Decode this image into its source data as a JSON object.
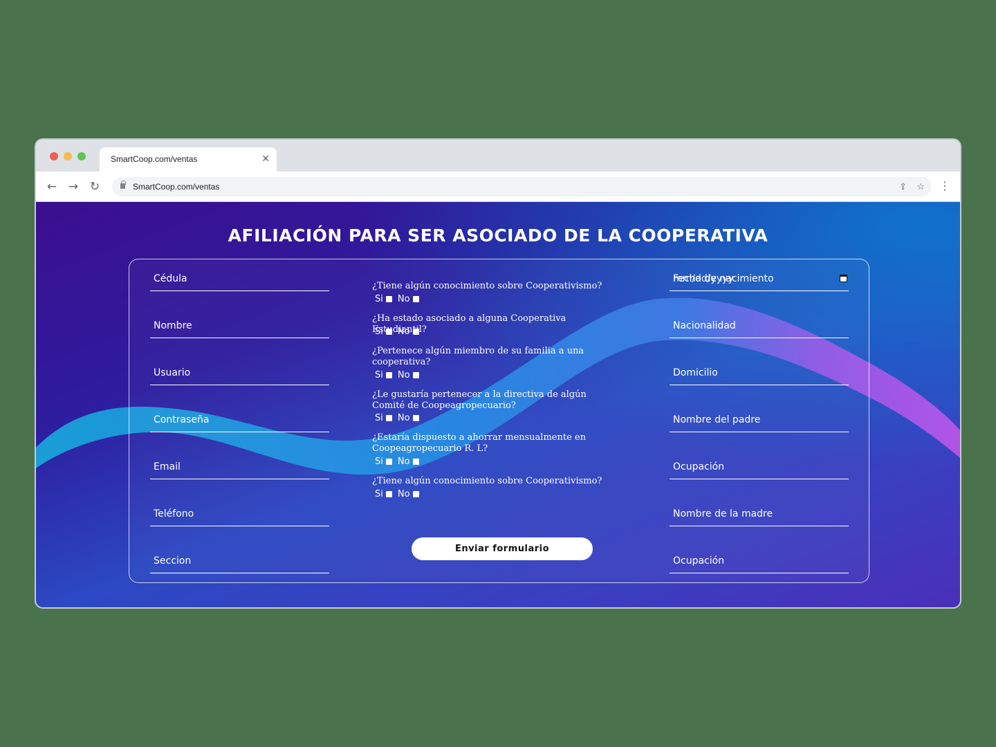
{
  "browser": {
    "tab_title": "SmartCoop.com/ventas",
    "url": "SmartCoop.com/ventas"
  },
  "page": {
    "title": "AFILIACIÓN PARA SER ASOCIADO DE LA COOPERATIVA",
    "left_fields": [
      "Cédula",
      "Nombre",
      "Usuario",
      "Contraseña",
      "Email",
      "Teléfono",
      "Seccion"
    ],
    "right_fields": [
      "Fecha de nacimiento",
      "Nacionalidad",
      "Domicilio",
      "Nombre del padre",
      "Ocupación",
      "Nombre de la madre",
      "Ocupación"
    ],
    "date_placeholder": "mm/dd/yyyy",
    "questions": [
      "¿Tiene algún conocimiento sobre Cooperativismo?",
      "¿Ha estado asociado a alguna Cooperativa Estudiantil?",
      "¿Pertenece algún miembro de su familia a una cooperativa?",
      "¿Le gustaría pertenecer a la directiva de algún Comité de Coopeagropecuario?",
      "¿Estaría dispuesto a ahorrar mensualmente en Coopeagropecuario R. L?",
      "¿Tiene algún conocimiento sobre Cooperativismo?"
    ],
    "yes_label": "Si",
    "no_label": "No",
    "submit_label": "Enviar formulario"
  }
}
